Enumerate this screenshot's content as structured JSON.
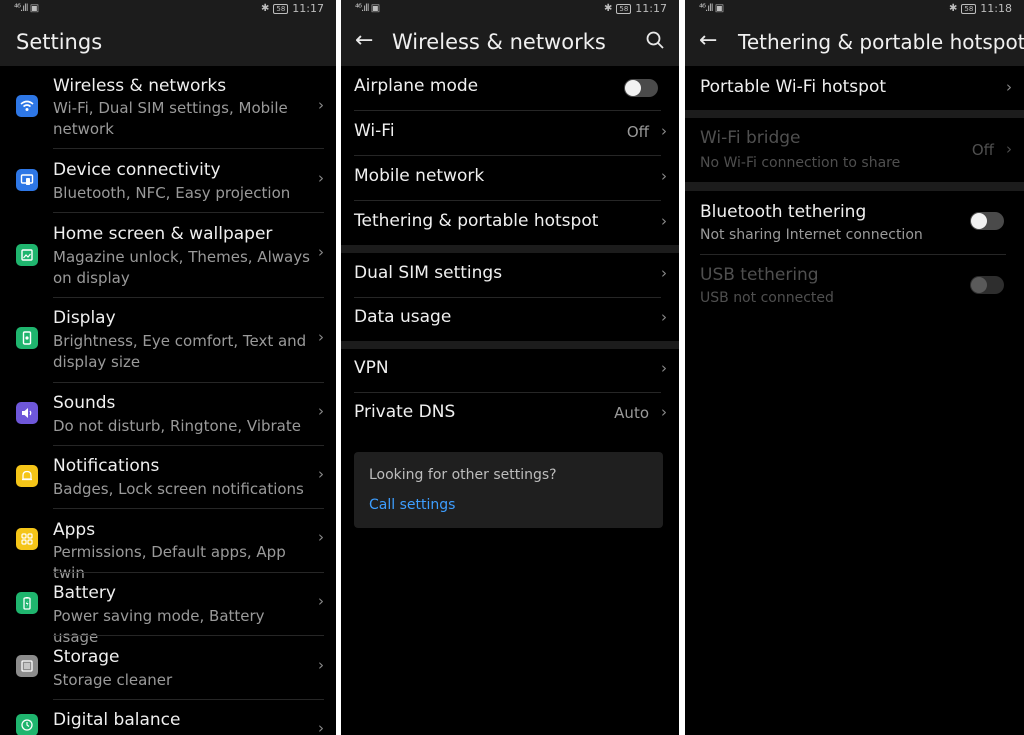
{
  "panels": [
    {
      "status": {
        "signal": "⁴⁶.ıll ▣",
        "battery": "58",
        "time": "11:17"
      },
      "title": "Settings",
      "items": [
        {
          "icon": "wifi-icon",
          "color": "#2e77e6",
          "title": "Wireless & networks",
          "subtitle": "Wi-Fi, Dual SIM settings, Mobile network"
        },
        {
          "icon": "device-connectivity-icon",
          "color": "#2e77e6",
          "title": "Device connectivity",
          "subtitle": "Bluetooth, NFC, Easy projection"
        },
        {
          "icon": "home-screen-icon",
          "color": "#1fb56e",
          "title": "Home screen & wallpaper",
          "subtitle": "Magazine unlock, Themes, Always on display"
        },
        {
          "icon": "display-icon",
          "color": "#1fb56e",
          "title": "Display",
          "subtitle": "Brightness, Eye comfort, Text and display size"
        },
        {
          "icon": "sound-icon",
          "color": "#6e57d9",
          "title": "Sounds",
          "subtitle": "Do not disturb, Ringtone, Vibrate"
        },
        {
          "icon": "bell-icon",
          "color": "#f5c518",
          "title": "Notifications",
          "subtitle": "Badges, Lock screen notifications"
        },
        {
          "icon": "apps-icon",
          "color": "#f5c518",
          "title": "Apps",
          "subtitle": "Permissions, Default apps, App twin"
        },
        {
          "icon": "battery-icon",
          "color": "#1fb56e",
          "title": "Battery",
          "subtitle": "Power saving mode, Battery usage"
        },
        {
          "icon": "storage-icon",
          "color": "#8c8c8c",
          "title": "Storage",
          "subtitle": "Storage cleaner"
        },
        {
          "icon": "digital-balance-icon",
          "color": "#1fb56e",
          "title": "Digital balance",
          "subtitle": ""
        }
      ]
    },
    {
      "status": {
        "signal": "⁴⁶.ıll ▣",
        "battery": "58",
        "time": "11:17"
      },
      "title": "Wireless & networks",
      "rows": [
        {
          "label": "Airplane mode",
          "value": "",
          "type": "toggle",
          "on": false
        },
        {
          "label": "Wi-Fi",
          "value": "Off",
          "type": "chevron"
        },
        {
          "label": "Mobile network",
          "value": "",
          "type": "chevron"
        },
        {
          "label": "Tethering & portable hotspot",
          "value": "",
          "type": "chevron"
        },
        {
          "label": "Dual SIM settings",
          "value": "",
          "type": "chevron"
        },
        {
          "label": "Data usage",
          "value": "",
          "type": "chevron"
        },
        {
          "label": "VPN",
          "value": "",
          "type": "chevron"
        },
        {
          "label": "Private DNS",
          "value": "Auto",
          "type": "chevron"
        }
      ],
      "card": {
        "question": "Looking for other settings?",
        "link": "Call settings"
      }
    },
    {
      "status": {
        "signal": "⁴⁶.ıll ▣",
        "battery": "58",
        "time": "11:18"
      },
      "title": "Tethering & portable hotspot",
      "rows": [
        {
          "label": "Portable Wi-Fi hotspot",
          "subtitle": "",
          "value": "",
          "type": "chevron",
          "enabled": true
        },
        {
          "label": "Wi-Fi bridge",
          "subtitle": "No Wi-Fi connection to share",
          "value": "Off",
          "type": "chevron",
          "enabled": false
        },
        {
          "label": "Bluetooth tethering",
          "subtitle": "Not sharing Internet connection",
          "value": "",
          "type": "toggle",
          "on": false,
          "enabled": true
        },
        {
          "label": "USB tethering",
          "subtitle": "USB not connected",
          "value": "",
          "type": "toggle",
          "on": false,
          "enabled": false
        }
      ]
    }
  ]
}
